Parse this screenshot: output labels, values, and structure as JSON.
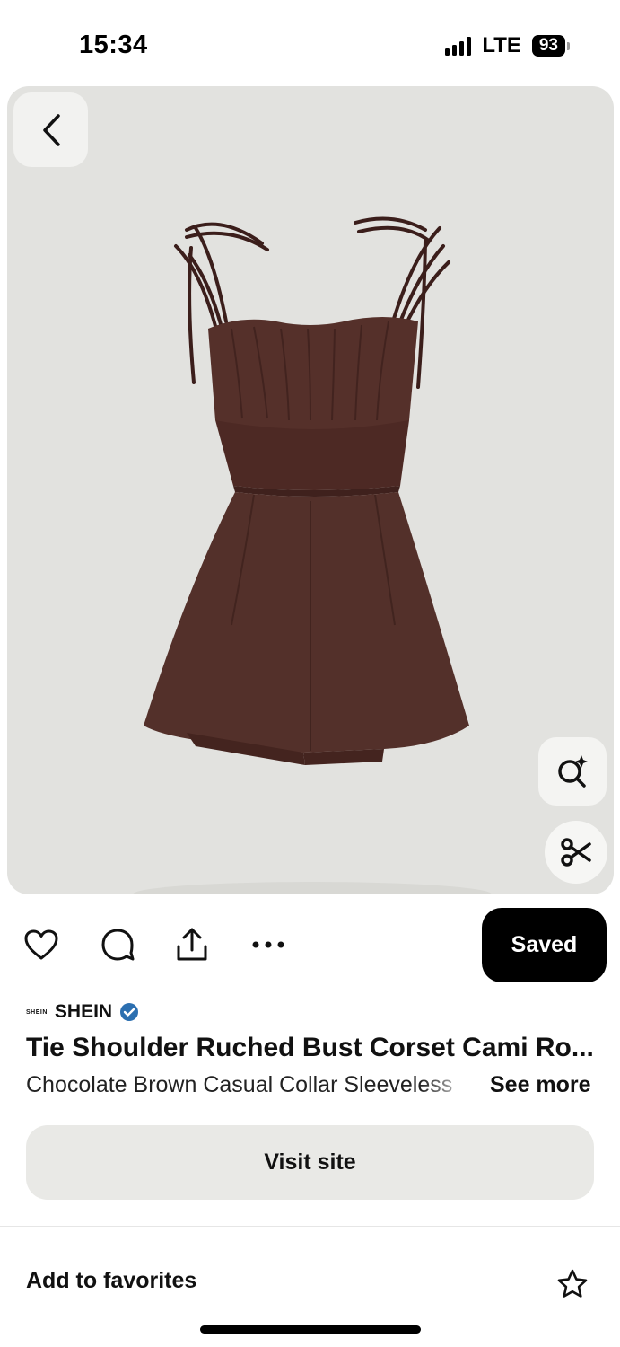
{
  "status_bar": {
    "time": "15:34",
    "network": "LTE",
    "battery": "93"
  },
  "hero": {
    "image_icon": "romper-dress-image",
    "background_color": "#e2e2df",
    "garment_color": "#4f2a25"
  },
  "actions": {
    "like_icon": "heart-icon",
    "comment_icon": "comment-bubble-icon",
    "share_icon": "share-icon",
    "more_icon": "more-dots-icon",
    "saved_label": "Saved"
  },
  "pin": {
    "brand_logo_text": "SHEIN",
    "brand_name": "SHEIN",
    "verified": true,
    "title": "Tie Shoulder Ruched Bust Corset Cami Ro...",
    "description": "Chocolate Brown Casual Collar Sleeveless",
    "see_more_label": "See more"
  },
  "visit_site_label": "Visit site",
  "favorites": {
    "label": "Add to favorites",
    "icon": "star-icon"
  }
}
